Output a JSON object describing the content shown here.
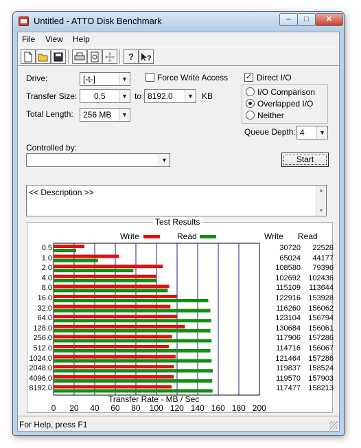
{
  "window": {
    "title": "Untitled - ATTO Disk Benchmark",
    "controls": [
      "–",
      "□",
      "✕"
    ]
  },
  "menu": [
    "File",
    "View",
    "Help"
  ],
  "toolbar": [
    "new-doc-icon",
    "open-folder-icon",
    "save-icon",
    "print-icon",
    "print-preview-icon",
    "move-cursor-icon",
    "help-icon",
    "context-help-icon"
  ],
  "settings": {
    "drive_label": "Drive:",
    "drive_value": "[-t-]",
    "force_write_label": "Force Write Access",
    "direct_io_label": "Direct I/O",
    "transfer_size_label": "Transfer Size:",
    "transfer_from": "0.5",
    "to_label": "to",
    "transfer_to": "8192.0",
    "kb_label": "KB",
    "total_length_label": "Total Length:",
    "total_length_value": "256 MB",
    "io_comparison_label": "I/O Comparison",
    "overlapped_io_label": "Overlapped I/O",
    "neither_label": "Neither",
    "queue_depth_label": "Queue Depth:",
    "queue_depth_value": "4",
    "controlled_by_label": "Controlled by:",
    "controlled_by_value": "",
    "start_label": "Start",
    "description": "<< Description >>"
  },
  "results": {
    "title": "Test Results",
    "write_label": "Write",
    "read_label": "Read",
    "col_write": "Write",
    "col_read": "Read"
  },
  "chart_data": {
    "type": "bar",
    "categories": [
      "0.5",
      "1.0",
      "2.0",
      "4.0",
      "8.0",
      "16.0",
      "32.0",
      "64.0",
      "128.0",
      "256.0",
      "512.0",
      "1024.0",
      "2048.0",
      "4096.0",
      "8192.0"
    ],
    "series": [
      {
        "name": "Write",
        "color": "#e01010",
        "values": [
          30720,
          65024,
          108580,
          102692,
          115109,
          122916,
          116260,
          123104,
          130684,
          117906,
          114716,
          121464,
          119837,
          119570,
          117477
        ]
      },
      {
        "name": "Read",
        "color": "#109010",
        "values": [
          22528,
          44177,
          79396,
          102436,
          113644,
          153928,
          156062,
          156794,
          156061,
          157286,
          156067,
          157286,
          158524,
          157903,
          158213
        ]
      }
    ],
    "value_unit_note": "Columns show KB/s; bars plotted in MB/s",
    "xlabel": "Transfer Rate - MB / Sec",
    "xlim": [
      0,
      200
    ],
    "xticks": [
      "0",
      "20",
      "40",
      "60",
      "80",
      "100",
      "120",
      "140",
      "160",
      "180",
      "200"
    ]
  },
  "status": "For Help, press F1"
}
